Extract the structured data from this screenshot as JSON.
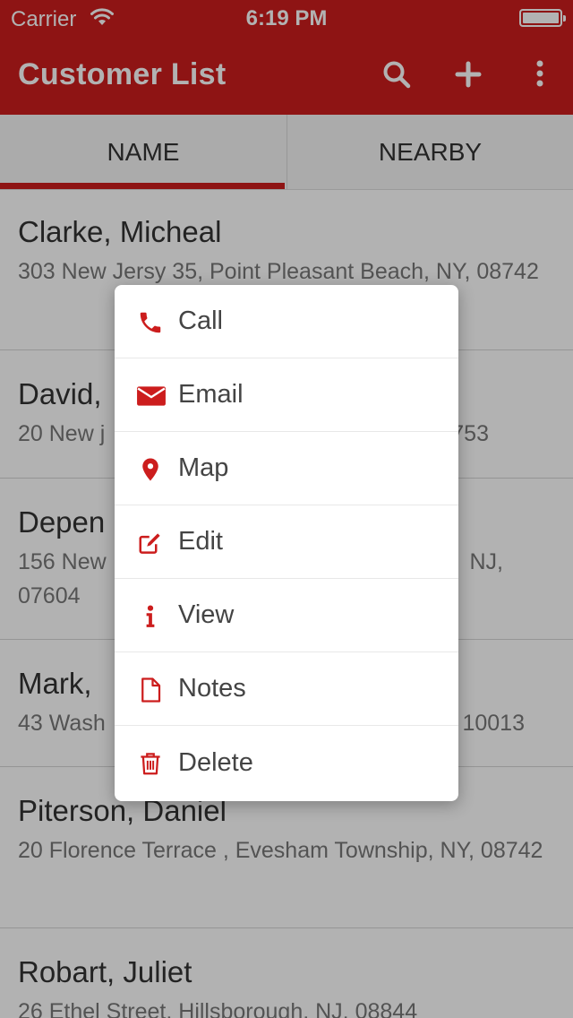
{
  "status_bar": {
    "carrier": "Carrier",
    "time": "6:19 PM"
  },
  "app_bar": {
    "title": "Customer List",
    "actions": [
      "search-icon",
      "plus-icon",
      "more-vertical-icon"
    ]
  },
  "tabs": [
    {
      "label": "NAME",
      "selected": true
    },
    {
      "label": "NEARBY",
      "selected": false
    }
  ],
  "customers": [
    {
      "name": "Clarke, Micheal",
      "address": "303 New Jersy 35, Point Pleasant Beach, NY, 08742"
    },
    {
      "name": "David,",
      "address": "20 New j",
      "address_tail": "753"
    },
    {
      "name": "Depen",
      "address": "156 New",
      "address_tail": "NJ,",
      "address_line2": "07604"
    },
    {
      "name": "Mark,",
      "address": "43 Wash",
      "address_tail": "10013"
    },
    {
      "name": "Piterson, Daniel",
      "address": "20 Florence Terrace , Evesham Township, NY, 08742"
    },
    {
      "name": "Robart, Juliet",
      "address": "26 Ethel Street, Hillsborough, NJ, 08844"
    }
  ],
  "menu": [
    {
      "label": "Call",
      "icon": "phone-icon"
    },
    {
      "label": "Email",
      "icon": "envelope-icon"
    },
    {
      "label": "Map",
      "icon": "map-pin-icon"
    },
    {
      "label": "Edit",
      "icon": "edit-icon"
    },
    {
      "label": "View",
      "icon": "info-icon"
    },
    {
      "label": "Notes",
      "icon": "document-icon"
    },
    {
      "label": "Delete",
      "icon": "trash-icon"
    }
  ],
  "colors": {
    "primary": "#cc1d1d",
    "text": "#333333",
    "subtext": "#777777"
  }
}
